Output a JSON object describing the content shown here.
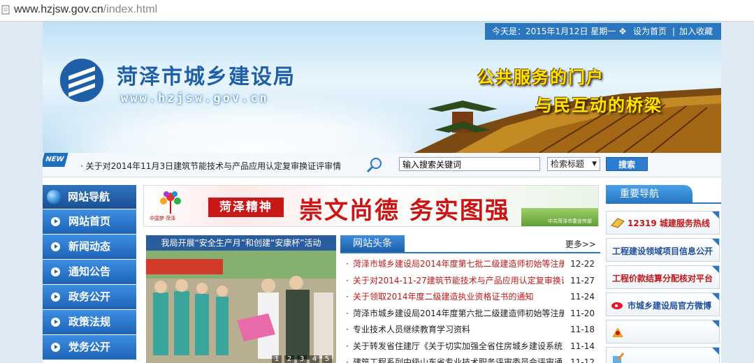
{
  "browser": {
    "url_host": "www.hzjsw.gov.cn",
    "url_path": "/index.html"
  },
  "header": {
    "date_text": "今天是：2015年1月12日  星期一",
    "set_home": "设为首页",
    "separator": "|",
    "add_favorite": "加入收藏",
    "site_title": "菏泽市城乡建设局",
    "site_url": "www.hzjsw.gov.cn",
    "slogan_line1": "公共服务的门户",
    "slogan_line2": "与民互动的桥梁",
    "new_badge": "NEW"
  },
  "search": {
    "notice": "· 关于对2014年11月3日建筑节能技术与产品应用认定复审换证评审情",
    "input_value": "输入搜索关键词",
    "select_value": "检索标题",
    "button_label": "搜索"
  },
  "left_nav": {
    "title": "网站导航",
    "items": [
      {
        "label": "网站首页"
      },
      {
        "label": "新闻动态"
      },
      {
        "label": "通知公告"
      },
      {
        "label": "政务公开"
      },
      {
        "label": "政策法规"
      },
      {
        "label": "党务公开"
      }
    ]
  },
  "ad_banner": {
    "emblem_text": "中国梦·菏泽",
    "tag": "菏泽精神",
    "slogan": "崇文尚德  务实图强",
    "credit": "中共菏泽市委宣传部"
  },
  "photo_news": {
    "caption": "我局开展“安全生产月”和创建“安康杯”活动",
    "pages": [
      "1",
      "2",
      "3",
      "4",
      "5"
    ]
  },
  "headlines": {
    "tab_label": "网站头条",
    "more_label": "更多>>",
    "items": [
      {
        "title": "菏泽市城乡建设局2014年度第七批二级建造师初始等注册",
        "date": "12-22",
        "color": "#c01818"
      },
      {
        "title": "关于对2014-11-27建筑节能技术与产品应用认定复审换证",
        "date": "11-27",
        "color": "#c01818"
      },
      {
        "title": "关于领取2014年度二级建造执业资格证书的通知",
        "date": "11-24",
        "color": "#c01818"
      },
      {
        "title": "菏泽市城乡建设局2014年度第六批二级建造师初始等注册",
        "date": "11-20",
        "color": "#222222"
      },
      {
        "title": "专业技术人员继续教育学习资料",
        "date": "11-18",
        "color": "#222222"
      },
      {
        "title": "关于转发省住建厅《关于切实加强全省住房城乡建设系统",
        "date": "11-14",
        "color": "#222222"
      },
      {
        "title": "建筑工程系列中级山东省专业技术职务评审委员会评审通",
        "date": "11-12",
        "color": "#222222"
      }
    ]
  },
  "right_nav": {
    "title": "重要导航",
    "cards": [
      {
        "label": "12319 城建服务热线"
      },
      {
        "label": "工程建设领域项目信息公开"
      },
      {
        "label": "工程价款结算分配核对平台"
      },
      {
        "label": "市城乡建设局官方微博"
      },
      {
        "label": ""
      },
      {
        "label": ""
      }
    ]
  }
}
